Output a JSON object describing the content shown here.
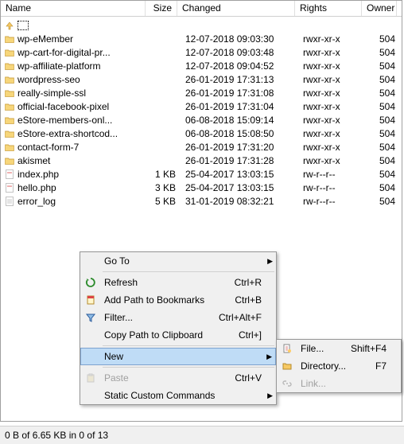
{
  "columns": {
    "name": "Name",
    "size": "Size",
    "changed": "Changed",
    "rights": "Rights",
    "owner": "Owner"
  },
  "updir": {
    "label": ".."
  },
  "files": [
    {
      "name": "wp-eMember",
      "size": "",
      "changed": "12-07-2018 09:03:30",
      "rights": "rwxr-xr-x",
      "owner": "504",
      "type": "folder"
    },
    {
      "name": "wp-cart-for-digital-pr...",
      "size": "",
      "changed": "12-07-2018 09:03:48",
      "rights": "rwxr-xr-x",
      "owner": "504",
      "type": "folder"
    },
    {
      "name": "wp-affiliate-platform",
      "size": "",
      "changed": "12-07-2018 09:04:52",
      "rights": "rwxr-xr-x",
      "owner": "504",
      "type": "folder"
    },
    {
      "name": "wordpress-seo",
      "size": "",
      "changed": "26-01-2019 17:31:13",
      "rights": "rwxr-xr-x",
      "owner": "504",
      "type": "folder"
    },
    {
      "name": "really-simple-ssl",
      "size": "",
      "changed": "26-01-2019 17:31:08",
      "rights": "rwxr-xr-x",
      "owner": "504",
      "type": "folder"
    },
    {
      "name": "official-facebook-pixel",
      "size": "",
      "changed": "26-01-2019 17:31:04",
      "rights": "rwxr-xr-x",
      "owner": "504",
      "type": "folder"
    },
    {
      "name": "eStore-members-onl...",
      "size": "",
      "changed": "06-08-2018 15:09:14",
      "rights": "rwxr-xr-x",
      "owner": "504",
      "type": "folder"
    },
    {
      "name": "eStore-extra-shortcod...",
      "size": "",
      "changed": "06-08-2018 15:08:50",
      "rights": "rwxr-xr-x",
      "owner": "504",
      "type": "folder"
    },
    {
      "name": "contact-form-7",
      "size": "",
      "changed": "26-01-2019 17:31:20",
      "rights": "rwxr-xr-x",
      "owner": "504",
      "type": "folder"
    },
    {
      "name": "akismet",
      "size": "",
      "changed": "26-01-2019 17:31:28",
      "rights": "rwxr-xr-x",
      "owner": "504",
      "type": "folder"
    },
    {
      "name": "index.php",
      "size": "1 KB",
      "changed": "25-04-2017 13:03:15",
      "rights": "rw-r--r--",
      "owner": "504",
      "type": "php"
    },
    {
      "name": "hello.php",
      "size": "3 KB",
      "changed": "25-04-2017 13:03:15",
      "rights": "rw-r--r--",
      "owner": "504",
      "type": "php"
    },
    {
      "name": "error_log",
      "size": "5 KB",
      "changed": "31-01-2019 08:32:21",
      "rights": "rw-r--r--",
      "owner": "504",
      "type": "file"
    }
  ],
  "menu": {
    "goto": {
      "label": "Go To"
    },
    "refresh": {
      "label": "Refresh",
      "shortcut": "Ctrl+R"
    },
    "addbm": {
      "label": "Add Path to Bookmarks",
      "shortcut": "Ctrl+B"
    },
    "filter": {
      "label": "Filter...",
      "shortcut": "Ctrl+Alt+F"
    },
    "copyp": {
      "label": "Copy Path to Clipboard",
      "shortcut": "Ctrl+]"
    },
    "new": {
      "label": "New"
    },
    "paste": {
      "label": "Paste",
      "shortcut": "Ctrl+V"
    },
    "custom": {
      "label": "Static Custom Commands"
    }
  },
  "submenu": {
    "file": {
      "label": "File...",
      "shortcut": "Shift+F4"
    },
    "dir": {
      "label": "Directory...",
      "shortcut": "F7"
    },
    "link": {
      "label": "Link..."
    }
  },
  "status": "0 B of 6.65 KB in 0 of 13"
}
